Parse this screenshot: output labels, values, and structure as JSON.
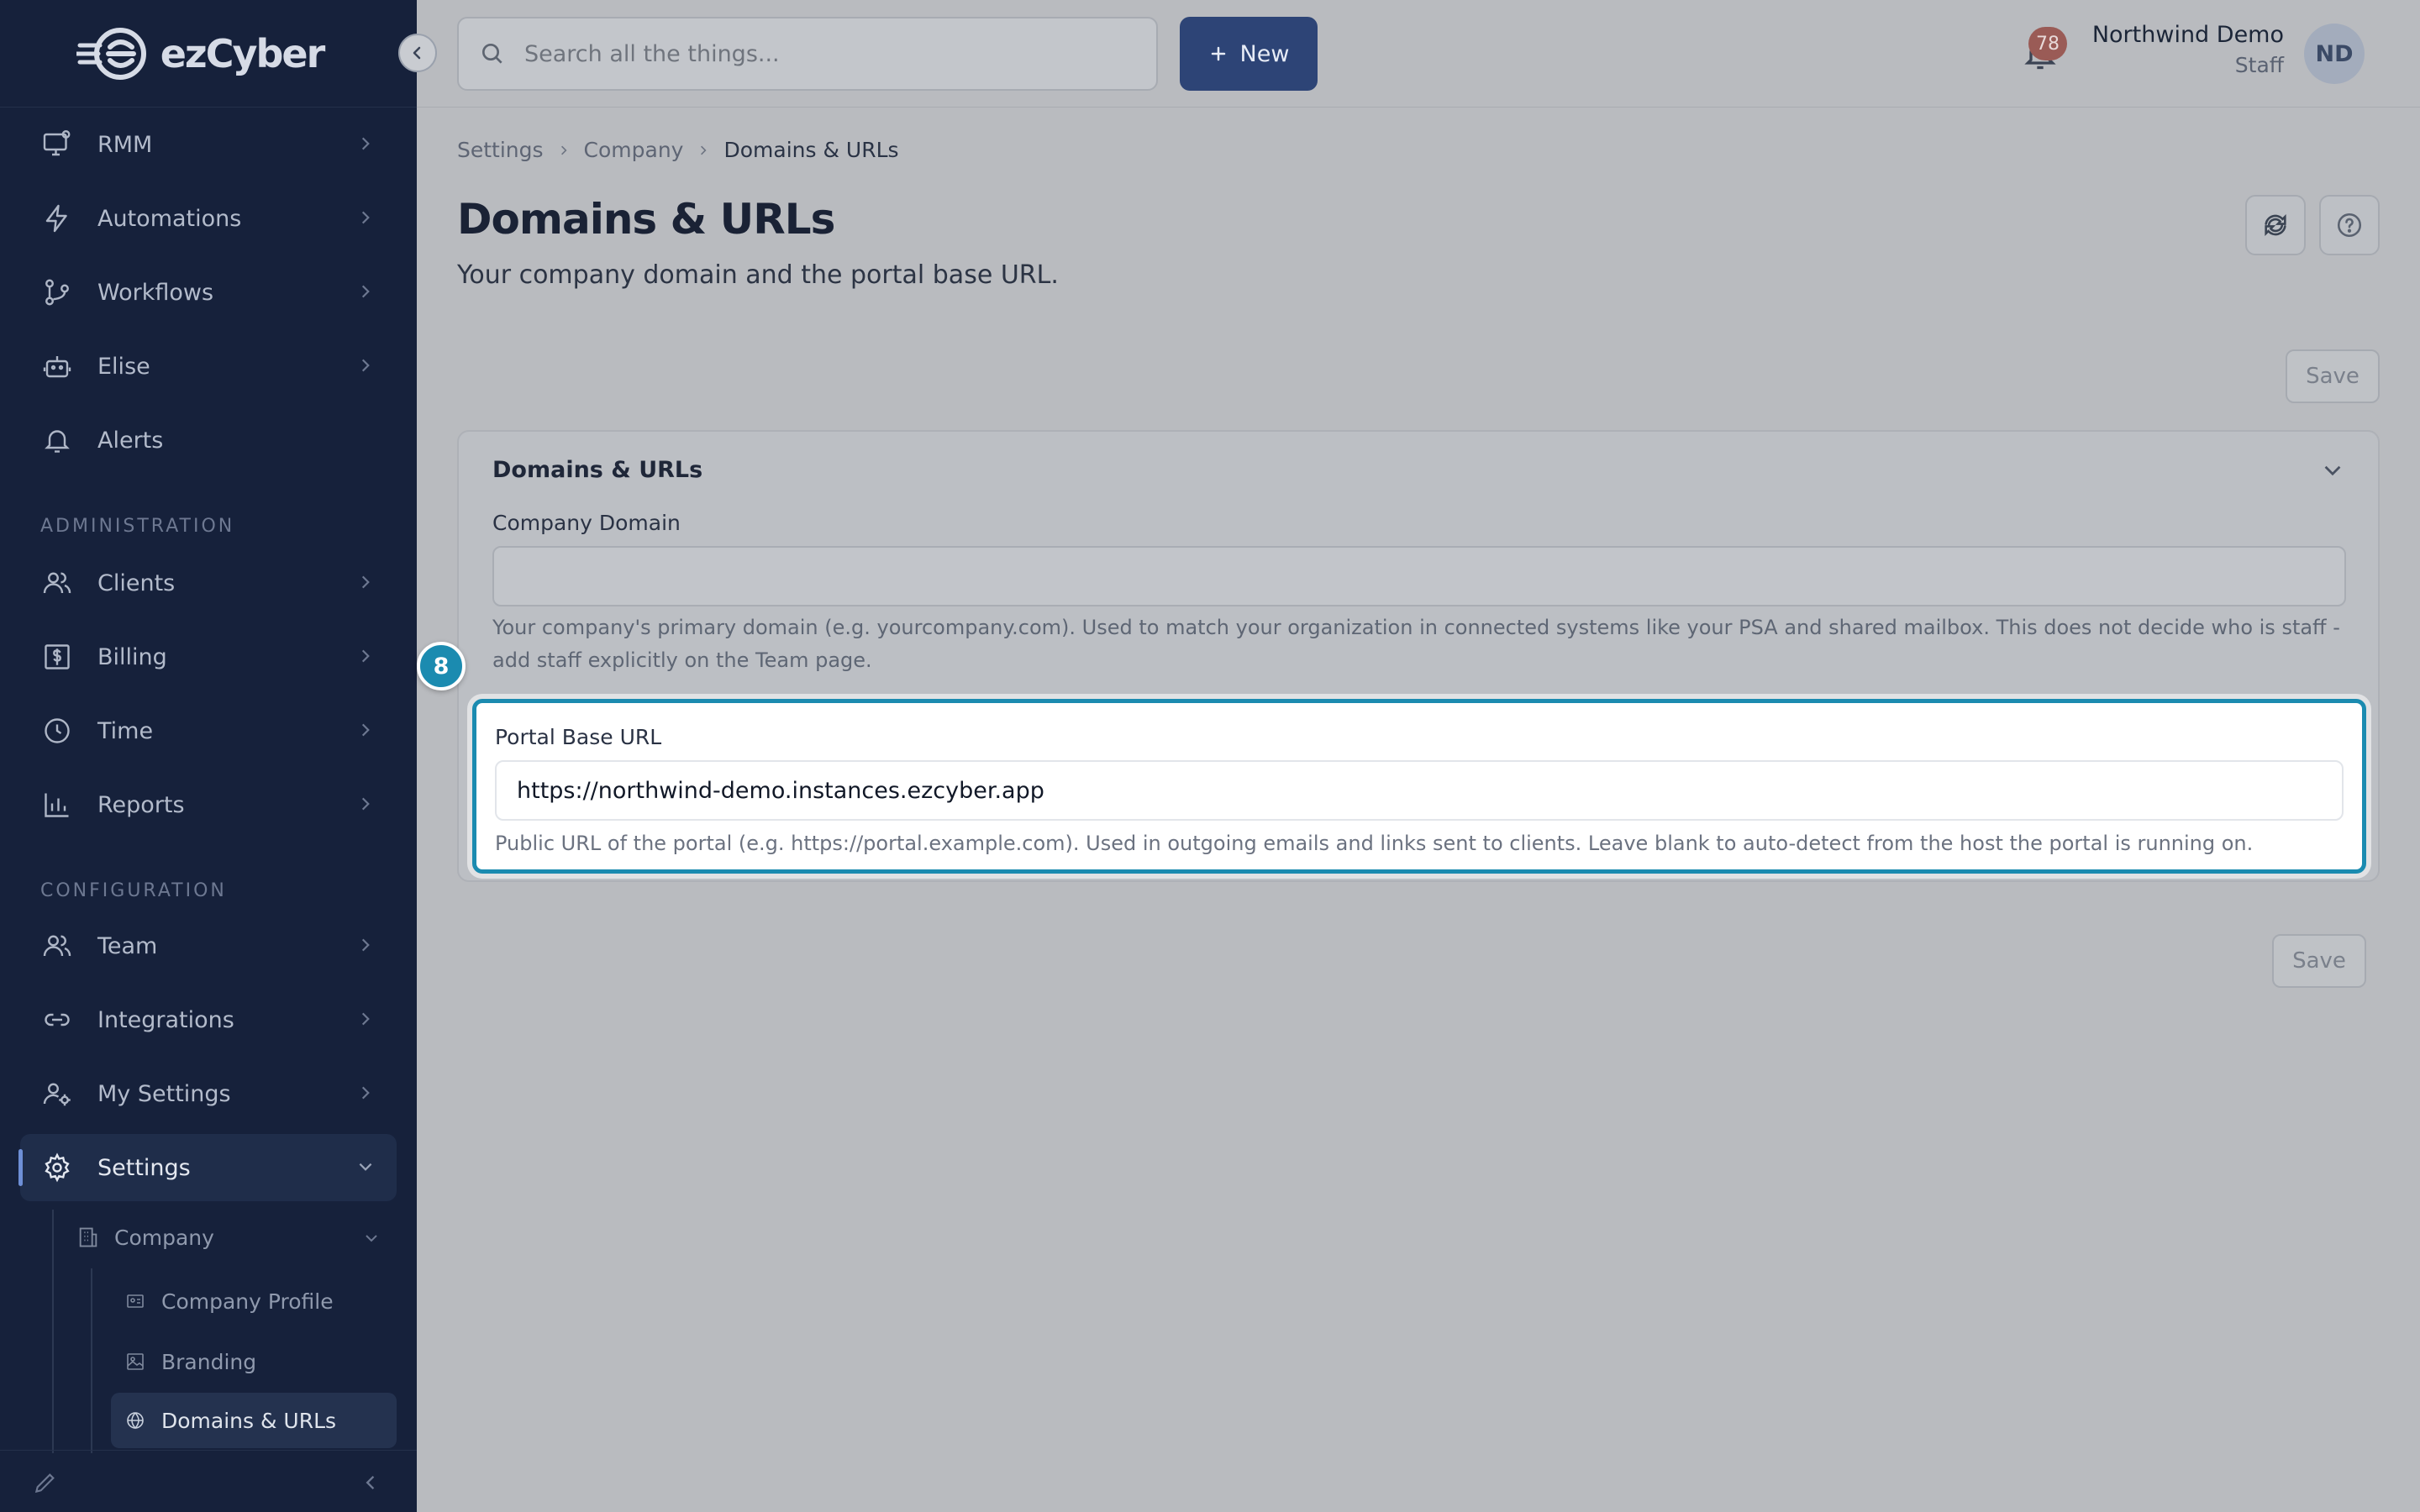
{
  "brand": {
    "name": "ezCyber"
  },
  "sidebar": {
    "items": [
      {
        "label": "RMM"
      },
      {
        "label": "Automations"
      },
      {
        "label": "Workflows"
      },
      {
        "label": "Elise"
      },
      {
        "label": "Alerts"
      }
    ],
    "sections": [
      {
        "title": "ADMINISTRATION",
        "items": [
          {
            "label": "Clients"
          },
          {
            "label": "Billing"
          },
          {
            "label": "Time"
          },
          {
            "label": "Reports"
          }
        ]
      },
      {
        "title": "CONFIGURATION",
        "items": [
          {
            "label": "Team"
          },
          {
            "label": "Integrations"
          },
          {
            "label": "My Settings"
          },
          {
            "label": "Settings"
          }
        ]
      }
    ],
    "settings_sub": {
      "group_label": "Company",
      "items": [
        {
          "label": "Company Profile"
        },
        {
          "label": "Branding"
        },
        {
          "label": "Domains & URLs"
        }
      ]
    }
  },
  "topbar": {
    "search_placeholder": "Search all the things...",
    "new_label": "New",
    "notification_count": "78",
    "user_name": "Northwind Demo",
    "user_role": "Staff",
    "avatar_initials": "ND"
  },
  "breadcrumb": [
    "Settings",
    "Company",
    "Domains & URLs"
  ],
  "page": {
    "title": "Domains & URLs",
    "subtitle": "Your company domain and the portal base URL.",
    "save_label": "Save"
  },
  "card": {
    "title": "Domains & URLs",
    "company_domain": {
      "label": "Company Domain",
      "value": "",
      "help": "Your company's primary domain (e.g. yourcompany.com). Used to match your organization in connected systems like your PSA and shared mailbox. This does not decide who is staff - add staff explicitly on the Team page."
    },
    "portal_base_url": {
      "label": "Portal Base URL",
      "value": "https://northwind-demo.instances.ezcyber.app",
      "help": "Public URL of the portal (e.g. https://portal.example.com). Used in outgoing emails and links sent to clients. Leave blank to auto-detect from the host the portal is running on."
    }
  },
  "tour": {
    "step": "8"
  },
  "colors": {
    "accent": "#2d4476",
    "highlight": "#1b8bb0",
    "sidebar_bg": "#16213b"
  }
}
